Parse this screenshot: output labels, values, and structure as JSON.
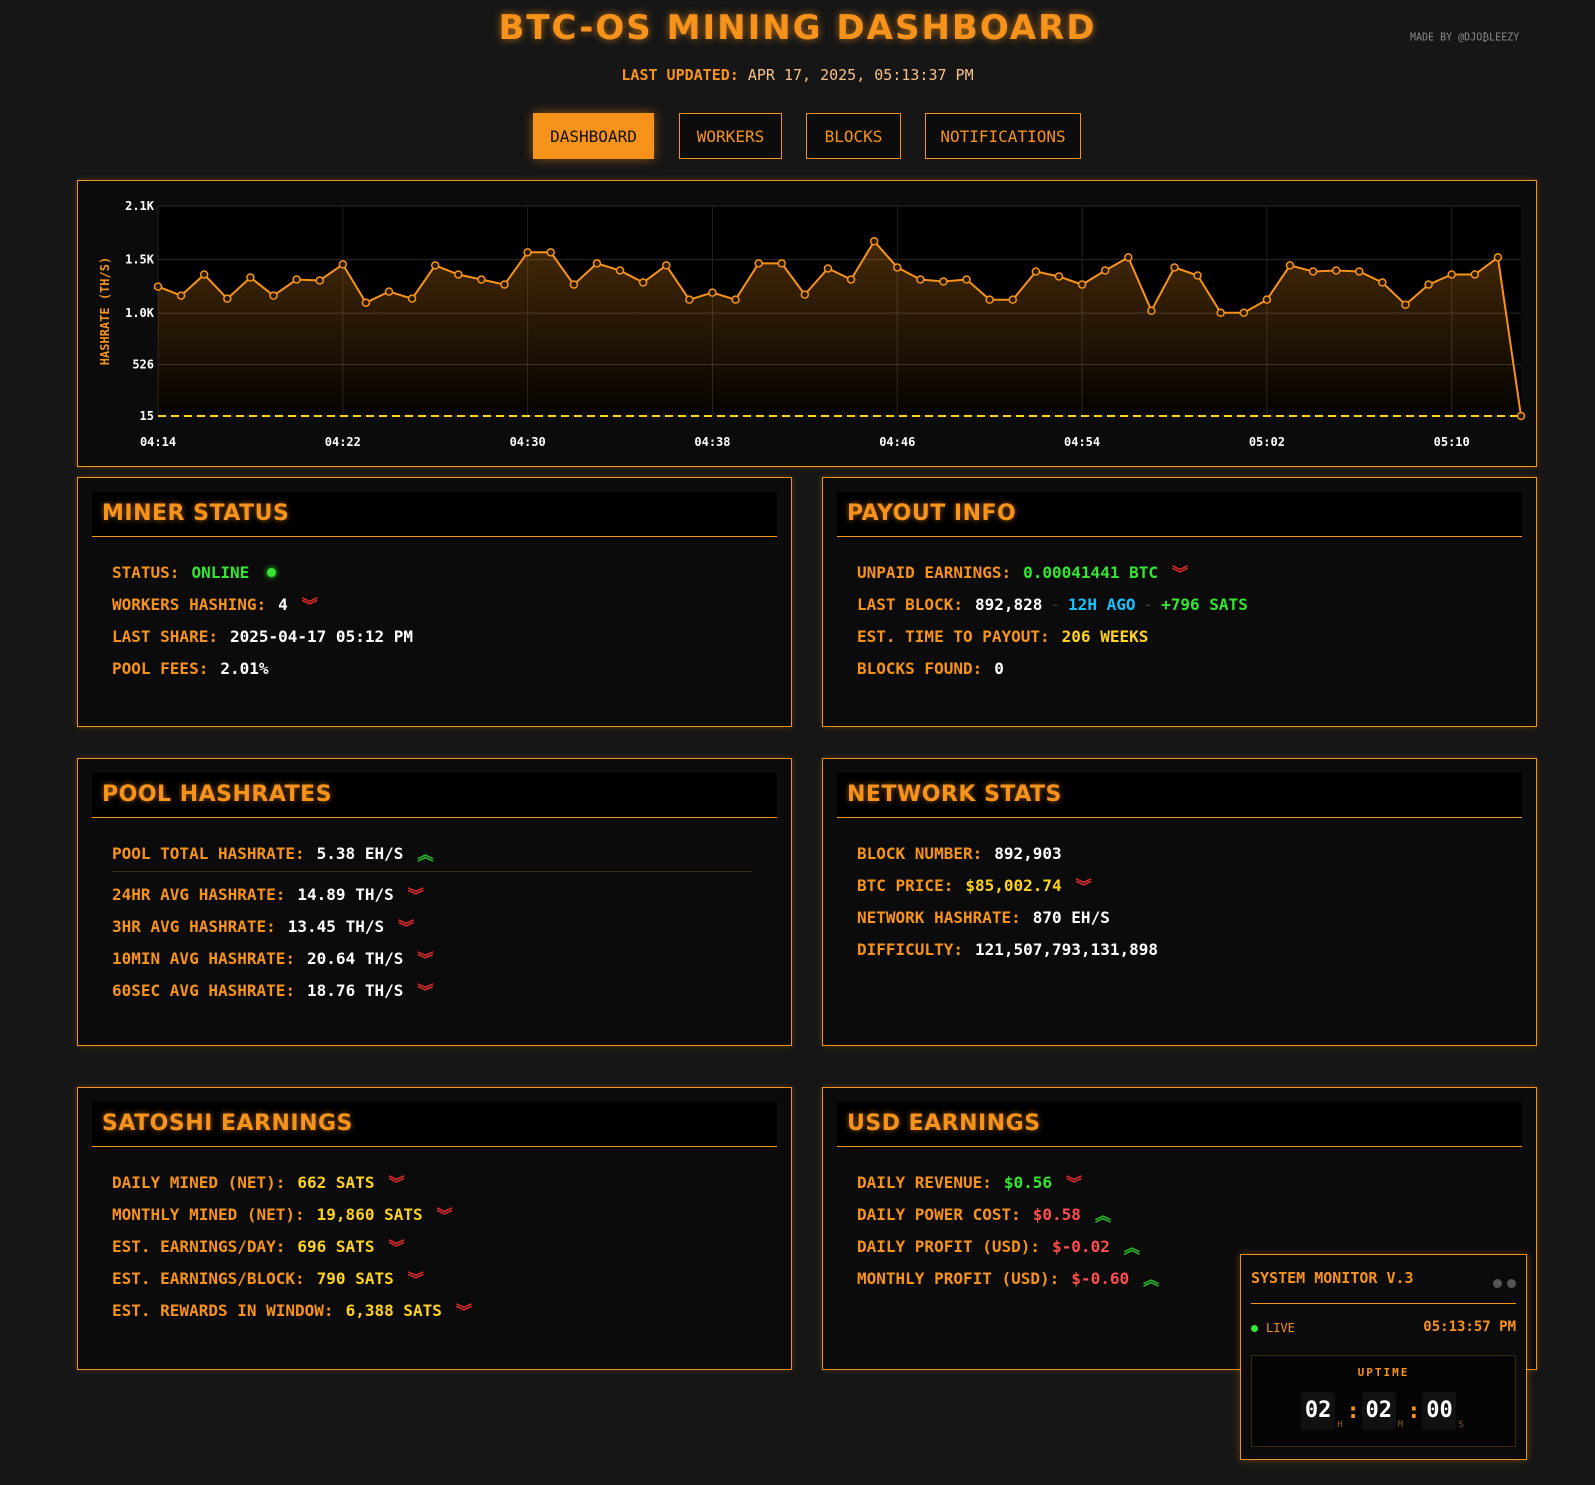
{
  "header": {
    "title": "BTC-OS MINING DASHBOARD",
    "made_by": "MADE BY @DJO₿LEEZY",
    "updated_label": "LAST UPDATED:",
    "updated_value": "APR 17, 2025, 05:13:37 PM"
  },
  "nav": [
    {
      "label": "DASHBOARD",
      "active": true
    },
    {
      "label": "WORKERS",
      "active": false
    },
    {
      "label": "BLOCKS",
      "active": false
    },
    {
      "label": "NOTIFICATIONS",
      "active": false
    }
  ],
  "colors": {
    "accent": "#f7931a",
    "green": "#32e632",
    "yellow": "#ffd21f",
    "red": "#ff4d4d",
    "cyan": "#17c3ff",
    "background": "#161616"
  },
  "chart_data": {
    "type": "line",
    "title": "",
    "ylabel": "HASHRATE (TH/S)",
    "xlabel": "",
    "y_ticks": [
      "2.1K",
      "1.5K",
      "1.0K",
      "526",
      "15"
    ],
    "x_ticks": [
      "04:14",
      "04:22",
      "04:30",
      "04:38",
      "04:46",
      "04:54",
      "05:02",
      "05:10"
    ],
    "ylim": [
      15,
      2100
    ],
    "x_start_minutes": 0,
    "x_end_minutes": 59,
    "baseline": 15,
    "grid": true,
    "series": [
      {
        "values": [
          1300,
          1210,
          1420,
          1180,
          1390,
          1210,
          1370,
          1360,
          1520,
          1140,
          1250,
          1180,
          1510,
          1420,
          1370,
          1320,
          1640,
          1640,
          1320,
          1530,
          1460,
          1340,
          1510,
          1170,
          1240,
          1170,
          1530,
          1530,
          1220,
          1480,
          1370,
          1750,
          1490,
          1370,
          1350,
          1370,
          1170,
          1170,
          1450,
          1400,
          1320,
          1460,
          1590,
          1060,
          1490,
          1410,
          1040,
          1040,
          1170,
          1510,
          1450,
          1460,
          1450,
          1340,
          1120,
          1320,
          1420,
          1420,
          1590,
          15
        ]
      }
    ]
  },
  "miner_status": {
    "title": "MINER STATUS",
    "rows": [
      {
        "label": "STATUS:",
        "value": "ONLINE"
      },
      {
        "label": "WORKERS HASHING:",
        "value": "4"
      },
      {
        "label": "LAST SHARE:",
        "value": "2025-04-17 05:12 PM"
      },
      {
        "label": "POOL FEES:",
        "value": "2.01%"
      }
    ]
  },
  "payout_info": {
    "title": "PAYOUT INFO",
    "unpaid_label": "UNPAID EARNINGS:",
    "unpaid_value": "0.00041441 BTC",
    "last_block_label": "LAST BLOCK:",
    "last_block_value": "892,828",
    "last_block_sep": "-",
    "last_block_ago": "12H AGO",
    "last_block_sats": "+796 SATS",
    "payout_time_label": "EST. TIME TO PAYOUT:",
    "payout_time_value": "206 WEEKS",
    "blocks_found_label": "BLOCKS FOUND:",
    "blocks_found_value": "0"
  },
  "pool_hashrates": {
    "title": "POOL HASHRATES",
    "total_label": "POOL TOTAL HASHRATE:",
    "total_value": "5.38 EH/S",
    "rows": [
      {
        "label": "24HR AVG HASHRATE:",
        "value": "14.89 TH/S"
      },
      {
        "label": "3HR AVG HASHRATE:",
        "value": "13.45 TH/S"
      },
      {
        "label": "10MIN AVG HASHRATE:",
        "value": "20.64 TH/S"
      },
      {
        "label": "60SEC AVG HASHRATE:",
        "value": "18.76 TH/S"
      }
    ]
  },
  "network_stats": {
    "title": "NETWORK STATS",
    "rows": [
      {
        "label": "BLOCK NUMBER:",
        "value": "892,903"
      },
      {
        "label": "BTC PRICE:",
        "value": "$85,002.74"
      },
      {
        "label": "NETWORK HASHRATE:",
        "value": "870 EH/S"
      },
      {
        "label": "DIFFICULTY:",
        "value": "121,507,793,131,898"
      }
    ]
  },
  "satoshi_earnings": {
    "title": "SATOSHI EARNINGS",
    "rows": [
      {
        "label": "DAILY MINED (NET):",
        "value": "662 SATS"
      },
      {
        "label": "MONTHLY MINED (NET):",
        "value": "19,860 SATS"
      },
      {
        "label": "EST. EARNINGS/DAY:",
        "value": "696 SATS"
      },
      {
        "label": "EST. EARNINGS/BLOCK:",
        "value": "790 SATS"
      },
      {
        "label": "EST. REWARDS IN WINDOW:",
        "value": "6,388 SATS"
      }
    ]
  },
  "usd_earnings": {
    "title": "USD EARNINGS",
    "rows": [
      {
        "label": "DAILY REVENUE:",
        "value": "$0.56"
      },
      {
        "label": "DAILY POWER COST:",
        "value": "$0.58"
      },
      {
        "label": "DAILY PROFIT (USD):",
        "value": "$-0.02"
      },
      {
        "label": "MONTHLY PROFIT (USD):",
        "value": "$-0.60"
      }
    ]
  },
  "system_monitor": {
    "title": "SYSTEM MONITOR V.3",
    "live_label": "LIVE",
    "time": "05:13:57 PM",
    "uptime_label": "UPTIME",
    "hours": "02",
    "minutes": "02",
    "seconds": "00",
    "h_unit": "H",
    "m_unit": "M",
    "s_unit": "S",
    "colon": ":"
  }
}
